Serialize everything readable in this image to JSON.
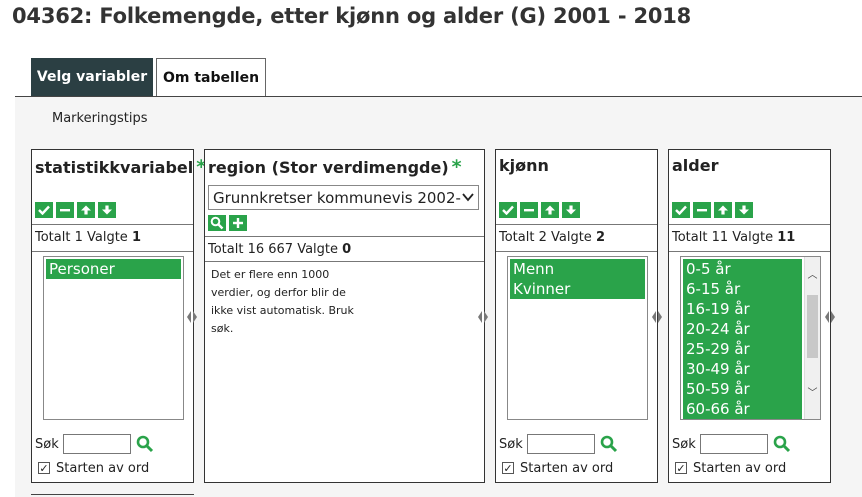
{
  "page": {
    "title": "04362: Folkemengde, etter kjønn og alder (G) 2001 - 2018"
  },
  "tabs": [
    {
      "label": "Velg variabler",
      "active": true
    },
    {
      "label": "Om tabellen",
      "active": false
    }
  ],
  "tips": "Markeringstips",
  "panels": {
    "statistikk": {
      "title": "statistikkvariabel",
      "required_mark": "*",
      "totals_label": "Totalt 1 Valgte ",
      "selected": "1",
      "options": [
        "Personer"
      ],
      "search_label": "Søk",
      "search_value": "",
      "starts_with_label": "Starten av ord",
      "starts_with_checked": true
    },
    "region": {
      "title": "region (Stor verdimengde)",
      "required_mark": "*",
      "select_value": "Grunnkretser kommunevis 2002-",
      "totals_label": "Totalt 16 667 Valgte ",
      "selected": "0",
      "note": "Det er flere enn 1000 verdier, og derfor blir de ikke vist automatisk. Bruk søk."
    },
    "kjonn": {
      "title": "kjønn",
      "totals_label": "Totalt 2 Valgte ",
      "selected": "2",
      "options": [
        "Menn",
        "Kvinner"
      ],
      "search_label": "Søk",
      "search_value": "",
      "starts_with_label": "Starten av ord",
      "starts_with_checked": true
    },
    "alder": {
      "title": "alder",
      "totals_label": "Totalt 11 Valgte ",
      "selected": "11",
      "options": [
        "0-5 år",
        "6-15 år",
        "16-19 år",
        "20-24 år",
        "25-29 år",
        "30-49 år",
        "50-59 år",
        "60-66 år"
      ],
      "search_label": "Søk",
      "search_value": "",
      "starts_with_label": "Starten av ord",
      "starts_with_checked": true
    }
  },
  "icons": {
    "select_all": "check-icon",
    "deselect_all": "minus-icon",
    "sort_up": "arrow-up-icon",
    "sort_down": "arrow-down-icon",
    "search": "magnifier-icon",
    "add": "plus-icon",
    "resize": "resize-handle-icon"
  },
  "colors": {
    "accent": "#2aa34a",
    "tab_active_bg": "#2b3f43",
    "required": "#2aa34a"
  }
}
